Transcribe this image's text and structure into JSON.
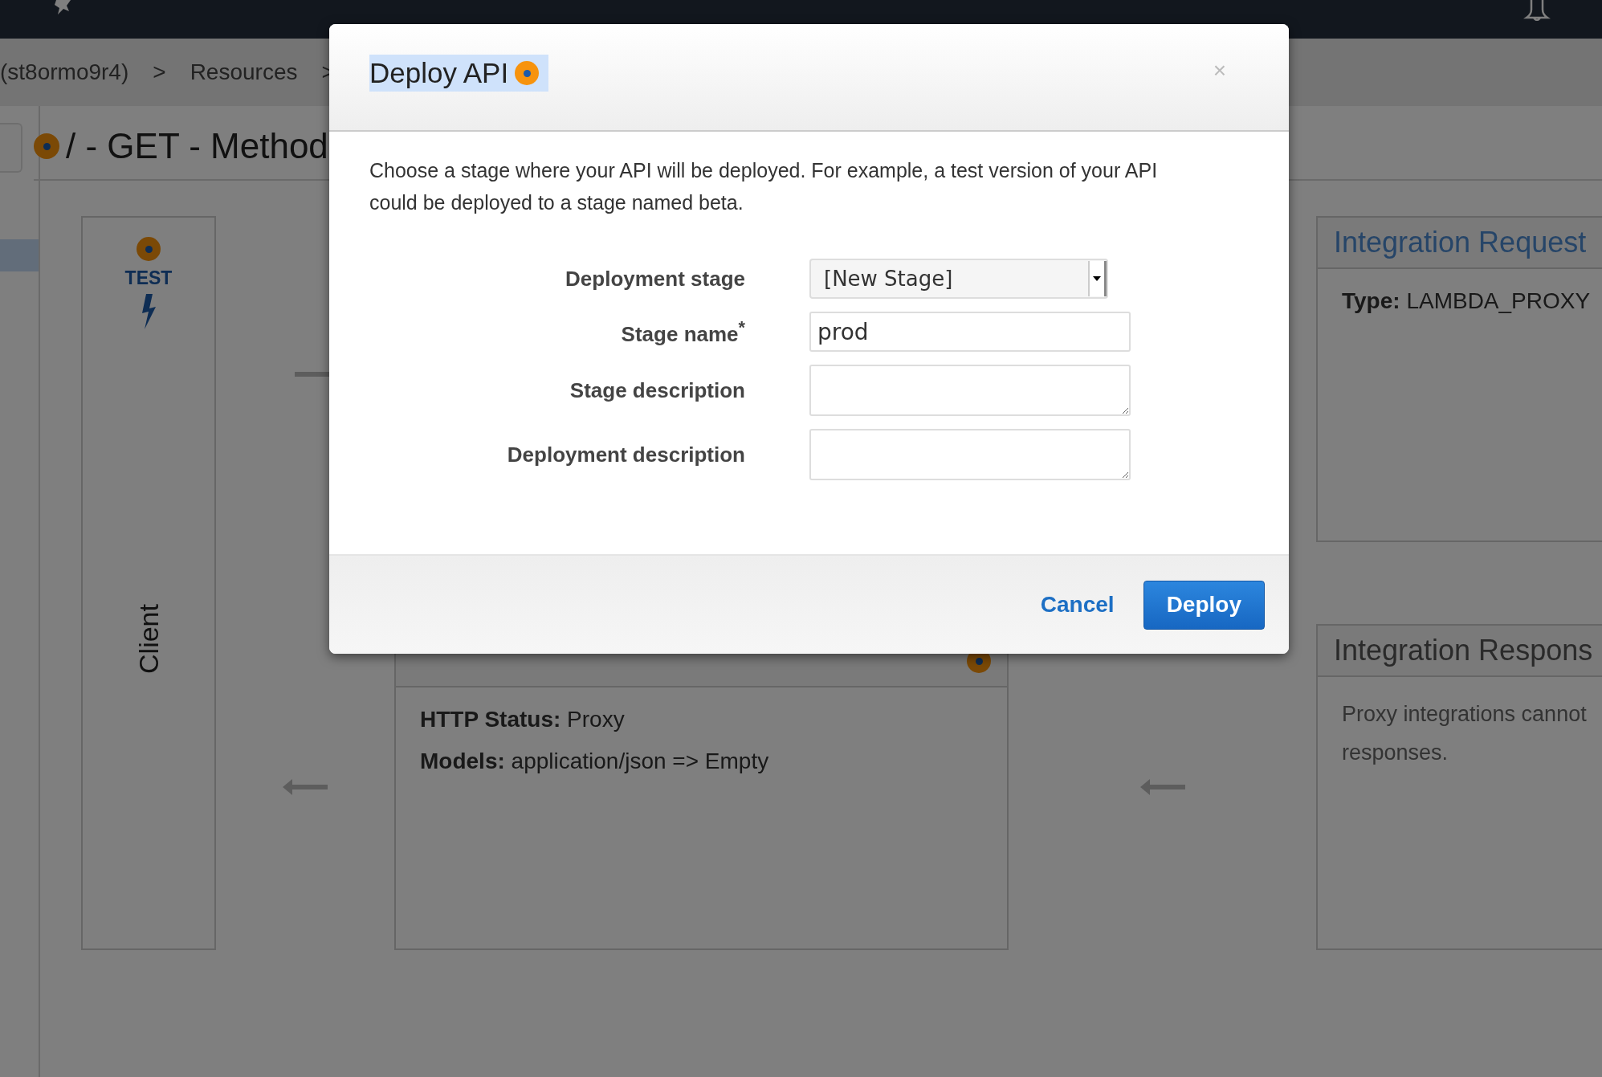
{
  "breadcrumb": [
    "(st8ormo9r4)",
    ">",
    "Resources",
    ">"
  ],
  "sidebar": {
    "items": [
      {
        "selected": true
      }
    ]
  },
  "page_title": "/ - GET - Method",
  "client": {
    "test_label": "TEST",
    "title": "Client"
  },
  "method_response": {
    "rows": [
      {
        "label": "HTTP Status:",
        "value": "Proxy"
      },
      {
        "label": "Models:",
        "value": "application/json => Empty"
      }
    ]
  },
  "integration_request": {
    "title": "Integration Request",
    "rows": [
      {
        "label": "Type:",
        "value": "LAMBDA_PROXY"
      }
    ]
  },
  "integration_response": {
    "title": "Integration Respons",
    "lines": [
      "Proxy integrations cannot",
      "responses."
    ]
  },
  "dialog": {
    "title": "Deploy API",
    "close": "×",
    "description": "Choose a stage where your API will be deployed. For example, a test version of your API could be deployed to a stage named beta.",
    "fields": [
      {
        "kind": "select",
        "label": "Deployment stage",
        "value": "[New Stage]"
      },
      {
        "kind": "text",
        "label": "Stage name$^{*}$",
        "value": "prod"
      },
      {
        "kind": "textarea",
        "label": "Stage description"
      },
      {
        "kind": "textarea",
        "label": "Deployment description"
      }
    ],
    "buttons": [
      {
        "kind": "link",
        "label": "Cancel"
      },
      {
        "kind": "primary",
        "label": "Deploy"
      }
    ]
  }
}
